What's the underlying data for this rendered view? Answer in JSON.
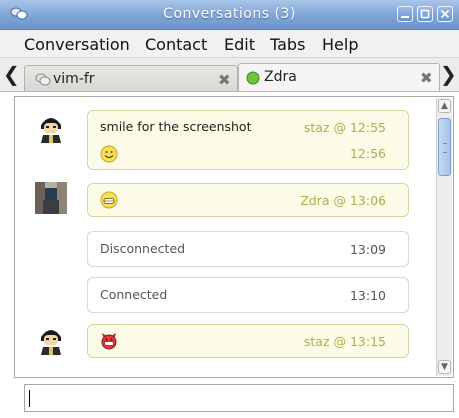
{
  "window": {
    "title": "Conversations (3)",
    "accent": "#7ea3d6"
  },
  "menu": {
    "items": [
      "Conversation",
      "Contact",
      "Edit",
      "Tabs",
      "Help"
    ]
  },
  "tabs": [
    {
      "label": "vim-fr",
      "icon": "chat-offline-icon",
      "active": false
    },
    {
      "label": "Zdra",
      "icon": "online-status-icon",
      "active": true
    }
  ],
  "messages": [
    {
      "type": "user",
      "text": "smile for the screenshot",
      "meta": "staz @ 12:55",
      "avatar": "staz-avatar"
    },
    {
      "type": "user",
      "text": "",
      "emoticon": "smile-emoticon",
      "meta": "12:56"
    },
    {
      "type": "user",
      "text": "",
      "emoticon": "grin-emoticon",
      "meta": "Zdra @ 13:06",
      "avatar": "zdra-avatar"
    },
    {
      "type": "status",
      "text": "Disconnected",
      "meta": "13:09"
    },
    {
      "type": "status",
      "text": "Connected",
      "meta": "13:10"
    },
    {
      "type": "user",
      "text": "",
      "emoticon": "devil-emoticon",
      "meta": "staz @ 13:15",
      "avatar": "staz-avatar"
    }
  ],
  "input": {
    "value": ""
  },
  "colors": {
    "bubble_bg": "#fbfbe8",
    "bubble_border": "#d3d79f",
    "meta_text": "#a7b24a"
  }
}
